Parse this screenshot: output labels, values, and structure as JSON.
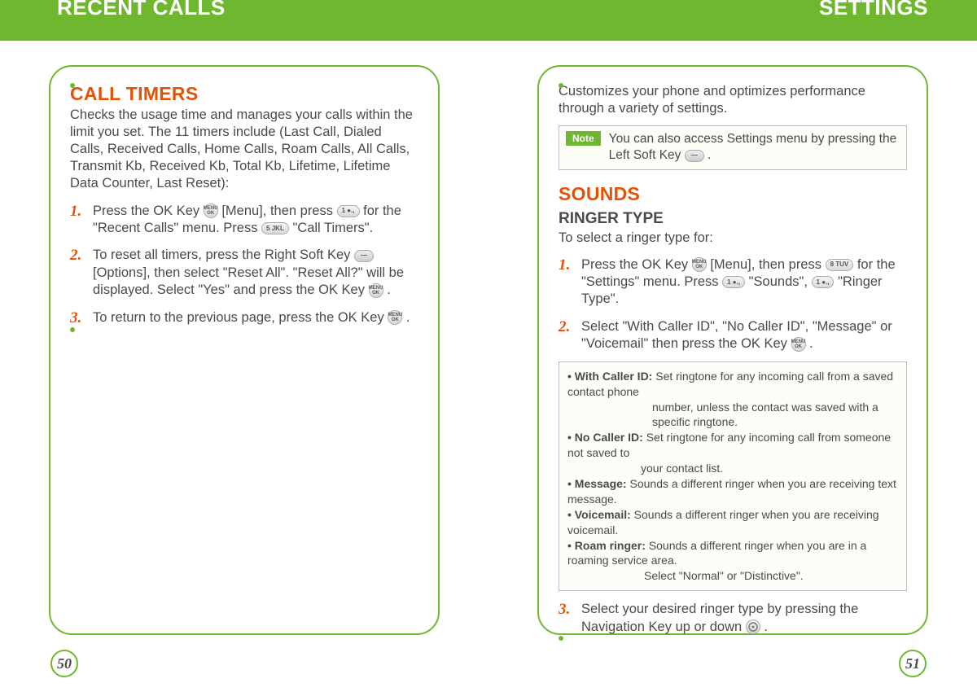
{
  "header": {
    "left": "RECENT CALLS",
    "right": "SETTINGS"
  },
  "left_page": {
    "title": "CALL TIMERS",
    "intro": "Checks the usage time and manages your calls within the limit you set. The 11 timers include (Last Call, Dialed Calls, Received Calls, Home Calls, Roam Calls, All Calls, Transmit Kb, Received Kb, Total Kb, Lifetime, Lifetime Data Counter,  Last Reset):",
    "steps": [
      {
        "n": "1.",
        "pre1": "Press the OK Key ",
        "aft1": " [Menu], then press ",
        "aft2": " for the \"Recent Calls\" menu.  Press ",
        "aft3": " \"Call Timers\"."
      },
      {
        "n": "2.",
        "pre1": "To reset all timers, press the Right Soft Key ",
        "aft1": " [Options], then select \"Reset All\".  \"Reset All?\" will be displayed.  Select \"Yes\" and press the OK Key ",
        "aft2": " ."
      },
      {
        "n": "3.",
        "pre1": "To return to the previous page, press the OK Key ",
        "aft1": " ."
      }
    ],
    "pagenum": "50"
  },
  "right_page": {
    "intro": "Customizes your phone and optimizes performance through a variety of settings.",
    "note_label": "Note",
    "note_text_a": "You can also access Settings menu by pressing the Left Soft Key ",
    "note_text_b": " .",
    "sounds_title": "SOUNDS",
    "ringer_title": "RINGER TYPE",
    "ringer_sub": "To select a ringer type for:",
    "steps": [
      {
        "n": "1.",
        "a": "Press the OK Key ",
        "b": " [Menu], then press ",
        "c": " for the \"Settings\" menu. Press ",
        "d": " \"Sounds\", ",
        "e": " \"Ringer Type\"."
      },
      {
        "n": "2.",
        "a": "Select \"With Caller ID\", \"No Caller ID\", \"Message\" or \"Voicemail\" then press the OK Key ",
        "b": " ."
      }
    ],
    "defs": {
      "d1t": "• With Caller ID: ",
      "d1a": "Set ringtone for any incoming call from a saved contact phone",
      "d1b": "number, unless the contact was saved with a specific ringtone.",
      "d2t": "• No Caller ID: ",
      "d2a": "Set ringtone for any incoming call from someone not saved to",
      "d2b": "your contact list.",
      "d3t": "• Message: ",
      "d3a": "Sounds a different ringer when you are receiving text message.",
      "d4t": "• Voicemail: ",
      "d4a": "Sounds a different ringer when you are receiving voicemail.",
      "d5t": "• Roam ringer: ",
      "d5a": "Sounds a different ringer when you are in a roaming service area.",
      "d5b": "Select \"Normal\" or \"Distinctive\"."
    },
    "step3": {
      "n": "3.",
      "a": "Select your desired ringer type by pressing the Navigation Key up or down ",
      "b": " ."
    },
    "pagenum": "51"
  },
  "keys": {
    "ok": "MENU\nOK",
    "k1": "1 ●.,",
    "k5": "5 JKL",
    "k8": "8 TUV",
    "softline": "—"
  }
}
